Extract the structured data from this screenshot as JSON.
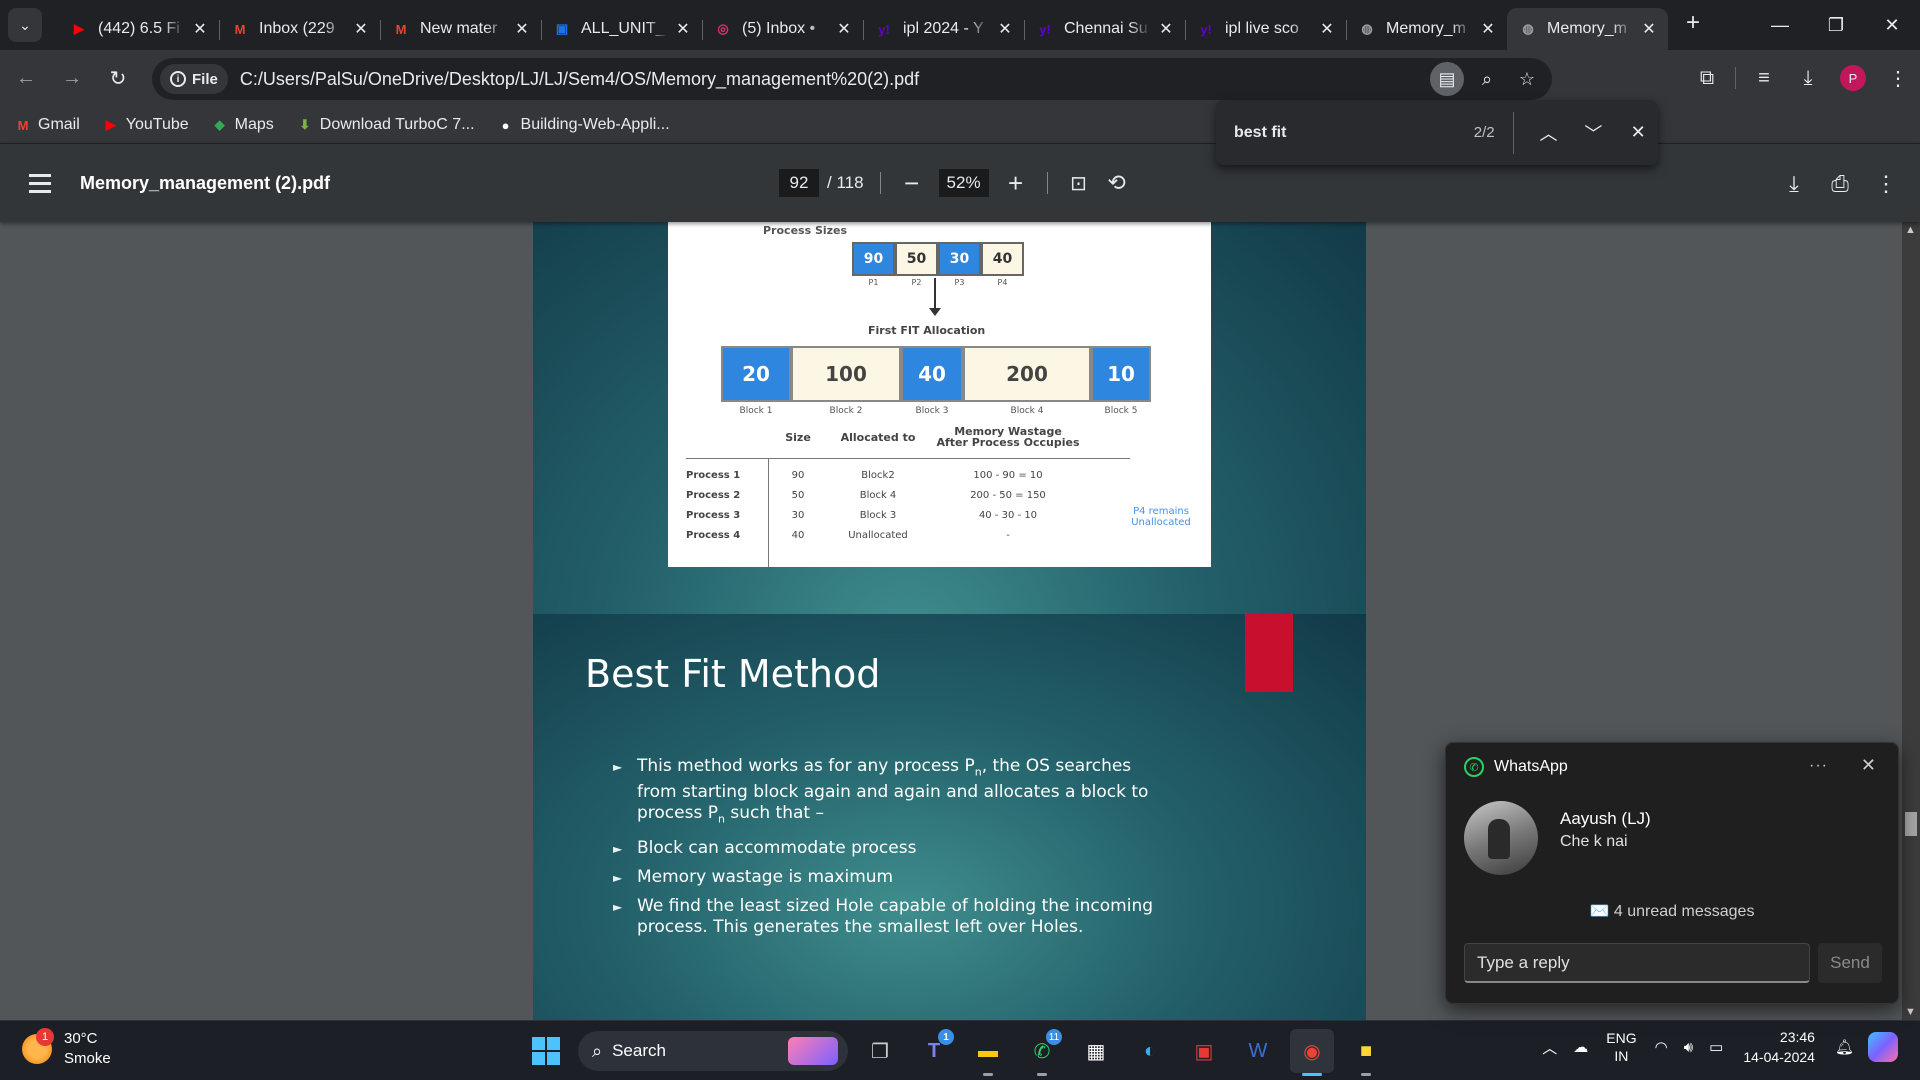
{
  "tabs": [
    {
      "icon": "youtube-icon",
      "title": "(442) 6.5 Fi",
      "color": "#ff0000",
      "glyph": "▶"
    },
    {
      "icon": "gmail-icon",
      "title": "Inbox (229",
      "color": "#ea4335",
      "glyph": "M"
    },
    {
      "icon": "gmail-icon",
      "title": "New mater",
      "color": "#ea4335",
      "glyph": "M"
    },
    {
      "icon": "contacts-icon",
      "title": "ALL_UNIT_",
      "color": "#1a73e8",
      "glyph": "▣"
    },
    {
      "icon": "instagram-icon",
      "title": "(5) Inbox •",
      "color": "#e1306c",
      "glyph": "◎"
    },
    {
      "icon": "yahoo-icon",
      "title": "ipl 2024 - Y",
      "color": "#6001d2",
      "glyph": "y!"
    },
    {
      "icon": "yahoo-icon",
      "title": "Chennai Su",
      "color": "#6001d2",
      "glyph": "y!"
    },
    {
      "icon": "yahoo-icon",
      "title": "ipl live sco",
      "color": "#6001d2",
      "glyph": "y!"
    },
    {
      "icon": "globe-icon",
      "title": "Memory_m",
      "color": "#9aa0a6",
      "glyph": "◍"
    },
    {
      "icon": "globe-icon",
      "title": "Memory_m",
      "color": "#9aa0a6",
      "glyph": "◍",
      "active": true
    }
  ],
  "address": {
    "chip": "File",
    "url": "C:/Users/PalSu/OneDrive/Desktop/LJ/LJ/Sem4/OS/Memory_management%20(2).pdf"
  },
  "profile_initial": "P",
  "bookmarks": [
    {
      "icon": "gmail-icon",
      "label": "Gmail",
      "color": "#ea4335",
      "glyph": "M"
    },
    {
      "icon": "youtube-icon",
      "label": "YouTube",
      "color": "#ff0000",
      "glyph": "▶"
    },
    {
      "icon": "maps-icon",
      "label": "Maps",
      "color": "#34a853",
      "glyph": "◆"
    },
    {
      "icon": "download-icon",
      "label": "Download TurboC 7...",
      "color": "#7cb342",
      "glyph": "⬇"
    },
    {
      "icon": "github-icon",
      "label": "Building-Web-Appli...",
      "color": "#ffffff",
      "glyph": "●"
    }
  ],
  "find": {
    "query": "best fit",
    "count": "2/2"
  },
  "pdf": {
    "title": "Memory_management (2).pdf",
    "page": "92",
    "total": "/ 118",
    "zoom": "52%"
  },
  "slide1": {
    "process_sizes_title": "Process Sizes",
    "processes": [
      {
        "value": "90",
        "label": "P1",
        "style": "blue"
      },
      {
        "value": "50",
        "label": "P2",
        "style": "cream"
      },
      {
        "value": "30",
        "label": "P3",
        "style": "blue"
      },
      {
        "value": "40",
        "label": "P4",
        "style": "cream"
      }
    ],
    "allocation_title": "First FIT Allocation",
    "blocks": [
      {
        "value": "20",
        "label": "Block 1",
        "style": "blue"
      },
      {
        "value": "100",
        "label": "Block 2",
        "style": "cream"
      },
      {
        "value": "40",
        "label": "Block 3",
        "style": "blue"
      },
      {
        "value": "200",
        "label": "Block 4",
        "style": "cream"
      },
      {
        "value": "10",
        "label": "Block 5",
        "style": "blue"
      }
    ],
    "table_headers": {
      "size": "Size",
      "allocated": "Allocated to",
      "wastage_1": "Memory Wastage",
      "wastage_2": "After Process Occupies"
    },
    "rows": [
      {
        "name": "Process 1",
        "size": "90",
        "alloc": "Block2",
        "waste": "100 - 90 = 10"
      },
      {
        "name": "Process 2",
        "size": "50",
        "alloc": "Block 4",
        "waste": "200 - 50 = 150"
      },
      {
        "name": "Process 3",
        "size": "30",
        "alloc": "Block 3",
        "waste": "40 - 30 - 10"
      },
      {
        "name": "Process 4",
        "size": "40",
        "alloc": "Unallocated",
        "waste": "-"
      }
    ],
    "note_1": "P4 remains",
    "note_2": "Unallocated"
  },
  "slide2": {
    "title": "Best Fit Method",
    "b1_a": "This method works as for any process P",
    "b1_sub": "n",
    "b1_b": ", the OS searches from starting block again and again and allocates a block to process P",
    "b1_sub2": "n",
    "b1_c": " such that –",
    "b2": "Block can accommodate process",
    "b3": "Memory wastage is maximum",
    "b4": "We find the least sized Hole capable of holding the incoming process. This generates the smallest left over Holes."
  },
  "whatsapp": {
    "app": "WhatsApp",
    "more": "···",
    "sender": "Aayush (LJ)",
    "message": "Che k nai",
    "unread": "✉️ 4 unread messages",
    "reply_placeholder": "Type a reply",
    "send": "Send"
  },
  "taskbar": {
    "weather_badge": "1",
    "temp": "30°C",
    "condition": "Smoke",
    "search": "Search",
    "teams_badge": "1",
    "whatsapp_badge": "11",
    "lang_1": "ENG",
    "lang_2": "IN",
    "time": "23:46",
    "date": "14-04-2024"
  }
}
